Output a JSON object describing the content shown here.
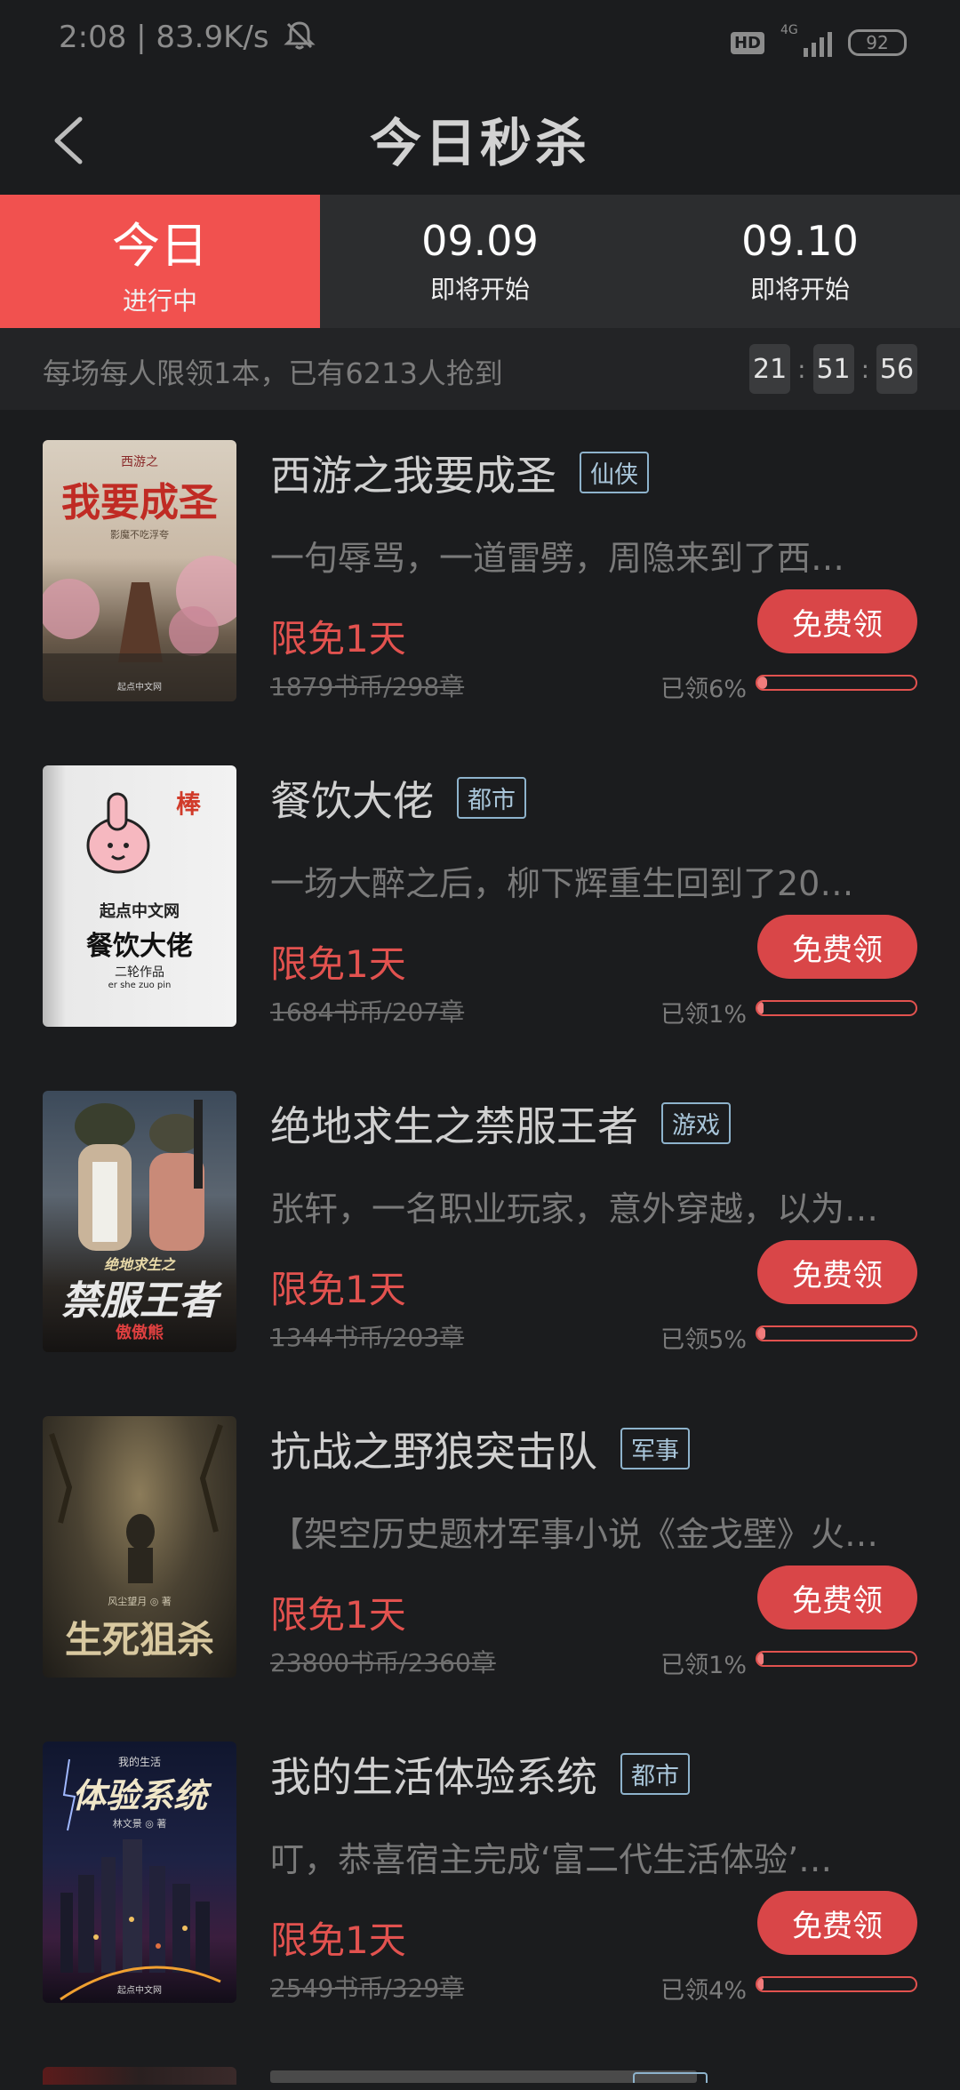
{
  "status_bar": {
    "time": "2:08 | 83.9K/s",
    "hd_label": "HD",
    "network": "4G",
    "battery": "92"
  },
  "header": {
    "title": "今日秒杀",
    "back_icon": "chevron-left-icon"
  },
  "tabs": [
    {
      "main": "今日",
      "sub": "进行中",
      "active": true
    },
    {
      "main": "09.09",
      "sub": "即将开始",
      "active": false
    },
    {
      "main": "09.10",
      "sub": "即将开始",
      "active": false
    }
  ],
  "info": {
    "text": "每场每人限领1本，已有6213人抢到",
    "countdown": {
      "h": "21",
      "m": "51",
      "s": "56",
      "sep": ":"
    }
  },
  "colors": {
    "accent": "#f1514f",
    "button": "#d94648",
    "tag": "#8eb3cc",
    "background": "#1b1c1e"
  },
  "books": [
    {
      "title": "西游之我要成圣",
      "tag": "仙侠",
      "desc": "一句辱骂，一道雷劈，周隐来到了西…",
      "promo": "限免1天",
      "original": "1879书币/298章",
      "button": "免费领",
      "claimed": "已领6%",
      "progress": 0.06,
      "cover": {
        "series": "西游之",
        "title": "我要成圣",
        "author": "影魔不吃浮夸",
        "publisher": "起点中文网"
      }
    },
    {
      "title": "餐饮大佬",
      "tag": "都市",
      "desc": "一场大醉之后，柳下辉重生回到了20…",
      "promo": "限免1天",
      "original": "1684书币/207章",
      "button": "免费领",
      "claimed": "已领1%",
      "progress": 0.01,
      "cover": {
        "badge": "棒",
        "site": "起点中文网",
        "title": "餐饮大佬",
        "sub": "二轮作品",
        "pinyin": "er she zuo pin"
      }
    },
    {
      "title": "绝地求生之禁服王者",
      "tag": "游戏",
      "desc": "张轩，一名职业玩家，意外穿越，以为…",
      "promo": "限免1天",
      "original": "1344书币/203章",
      "button": "免费领",
      "claimed": "已领5%",
      "progress": 0.05,
      "cover": {
        "series": "绝地求生之",
        "title": "禁服王者",
        "author": "傲傲熊"
      }
    },
    {
      "title": "抗战之野狼突击队",
      "tag": "军事",
      "desc": "【架空历史题材军事小说《金戈壁》火…",
      "promo": "限免1天",
      "original": "23800书币/2360章",
      "button": "免费领",
      "claimed": "已领1%",
      "progress": 0.01,
      "cover": {
        "author": "风尘望月 ◎ 著",
        "title": "生死狙杀"
      }
    },
    {
      "title": "我的生活体验系统",
      "tag": "都市",
      "desc": "叮，恭喜宿主完成‘富二代生活体验’…",
      "promo": "限免1天",
      "original": "2549书币/329章",
      "button": "免费领",
      "claimed": "已领4%",
      "progress": 0.04,
      "cover": {
        "series": "我的生活",
        "title": "体验系统",
        "author": "林文景 ◎ 著",
        "publisher": "起点中文网"
      }
    }
  ]
}
